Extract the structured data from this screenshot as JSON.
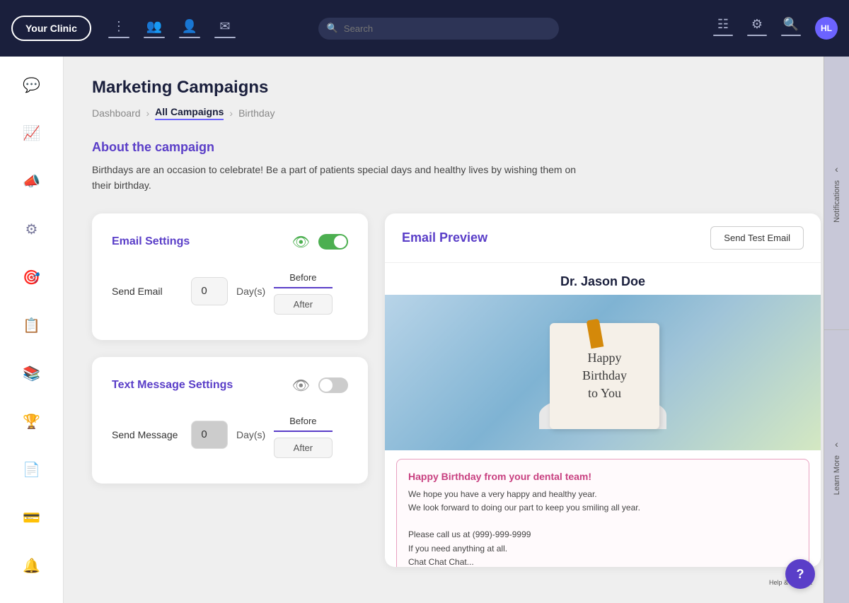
{
  "app": {
    "clinic_name": "Your Clinic",
    "search_placeholder": "Search"
  },
  "topnav": {
    "right_icons": [
      "list-icon",
      "gear-icon",
      "search-icon"
    ],
    "avatar_initials": "HL"
  },
  "sidebar": {
    "icons": [
      "chat-icon",
      "chart-icon",
      "megaphone-icon",
      "settings-icon",
      "user-target-icon",
      "clipboard-icon",
      "facebook-icon",
      "trophy-icon",
      "card-icon",
      "credit-icon",
      "bell-icon"
    ]
  },
  "page": {
    "title": "Marketing Campaigns",
    "breadcrumb": {
      "items": [
        "Dashboard",
        "All Campaigns",
        "Birthday"
      ]
    },
    "campaign_section": {
      "title": "About the campaign",
      "description": "Birthdays are an occasion to celebrate! Be a part of patients special days and healthy lives by wishing them on their birthday."
    }
  },
  "email_settings": {
    "title": "Email Settings",
    "eye_visible": true,
    "toggle_on": true,
    "send_label": "Send Email",
    "day_value": "0",
    "days_label": "Day(s)",
    "before_label": "Before",
    "after_label": "After"
  },
  "text_settings": {
    "title": "Text Message Settings",
    "eye_visible": false,
    "toggle_on": false,
    "send_label": "Send Message",
    "day_value": "0",
    "days_label": "Day(s)",
    "before_label": "Before",
    "after_label": "After"
  },
  "email_preview": {
    "title": "Email Preview",
    "test_email_btn": "Send Test Email",
    "doctor_name": "Dr. Jason Doe",
    "birthday_card_text": "Happy Birthday to You",
    "message_title": "Happy Birthday from your dental team!",
    "message_body_line1": "We hope you have a very happy and healthy year.",
    "message_body_line2": "We look forward to doing our part to keep you smiling all year.",
    "message_body_line3": "",
    "message_body_line4": "Please call us at (999)-999-9999",
    "message_body_line5": "If you need anything at all.",
    "message_body_line6": "Chat Chat Chat..."
  },
  "side_panels": {
    "notifications_label": "Notifications",
    "learn_more_label": "Learn More"
  },
  "help": {
    "label": "Help & Support"
  }
}
